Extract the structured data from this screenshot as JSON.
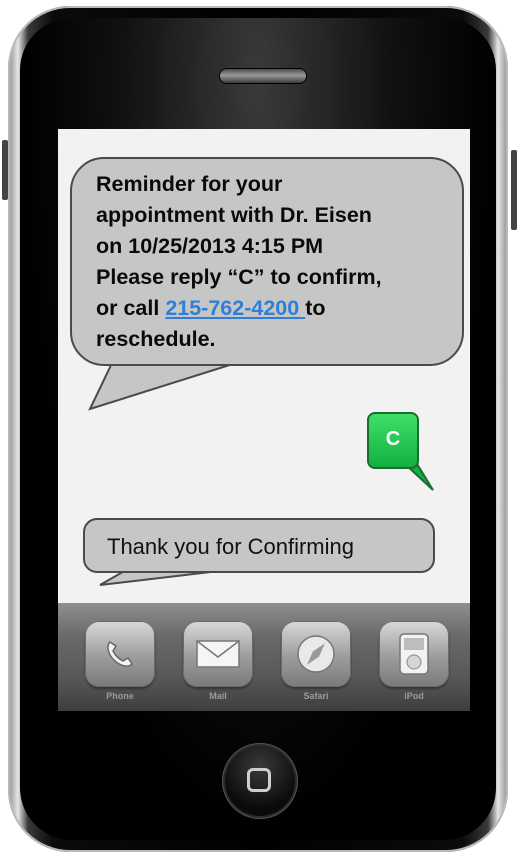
{
  "message_incoming": {
    "line1": "Reminder for your",
    "line2": "appointment with Dr. Eisen",
    "line3": "on 10/25/2013 4:15 PM",
    "line4": "Please reply “C” to confirm,",
    "line5_prefix": "or call ",
    "phone_link": "215-762-4200 ",
    "line5_suffix": "to",
    "line6": "reschedule."
  },
  "reply_confirm": "C",
  "message_reply": "Thank you for Confirming",
  "dock": {
    "items": [
      {
        "label": "Phone",
        "icon": "phone-icon"
      },
      {
        "label": "Mail",
        "icon": "mail-icon"
      },
      {
        "label": "Safari",
        "icon": "safari-icon"
      },
      {
        "label": "iPod",
        "icon": "ipod-icon"
      }
    ]
  },
  "colors": {
    "bubble_gray": "#c6c6c6",
    "confirm_green": "#1fc04a",
    "link_blue": "#2f7fd8"
  }
}
